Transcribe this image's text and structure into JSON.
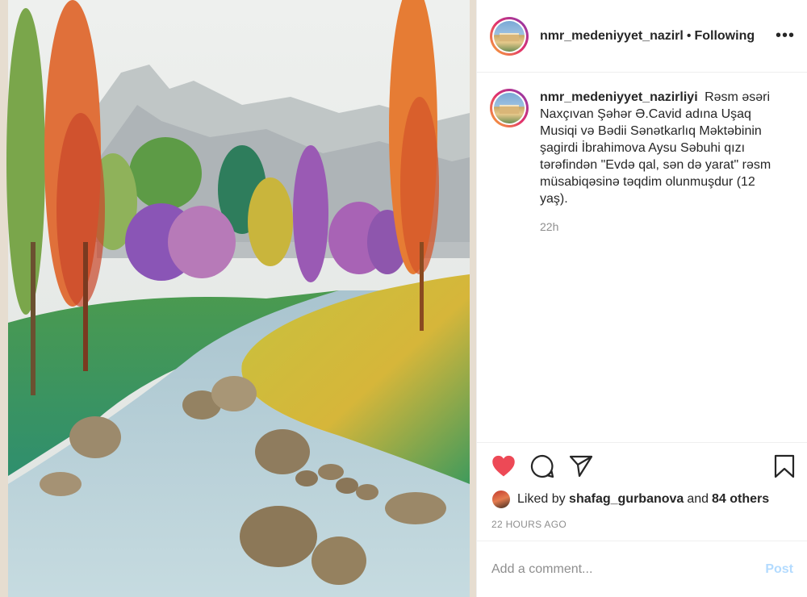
{
  "post": {
    "username": "nmr_medeniyyet_nazirliyi",
    "header_username": "nmr_medeniyyet_nazirl",
    "separator": "•",
    "follow_status": "Following",
    "more_glyph": "•••",
    "caption_text": "Rəsm əsəri Naxçıvan Şəhər Ə.Cavid adına Uşaq Musiqi və Bədii Sənətkarlıq Məktəbinin şagirdi İbrahimova Aysu Səbuhi qızı tərəfindən \"Evdə qal, sən də yarat\" rəsm müsabiqəsinə təqdim olunmuşdur (12 yaş).",
    "caption_age": "22h"
  },
  "likes": {
    "prefix": "Liked by",
    "liker": "shafag_gurbanova",
    "middle": "and",
    "others": "84 others"
  },
  "timestamp": "22 HOURS AGO",
  "comment": {
    "placeholder": "Add a comment...",
    "post_label": "Post"
  },
  "icons": {
    "like": "heart-filled-icon",
    "comment": "comment-bubble-icon",
    "share": "paper-plane-icon",
    "save": "bookmark-icon",
    "more": "more-options-icon"
  },
  "colors": {
    "like_red": "#ed4956",
    "post_disabled": "#b3dbff",
    "muted": "#8e8e8e"
  }
}
